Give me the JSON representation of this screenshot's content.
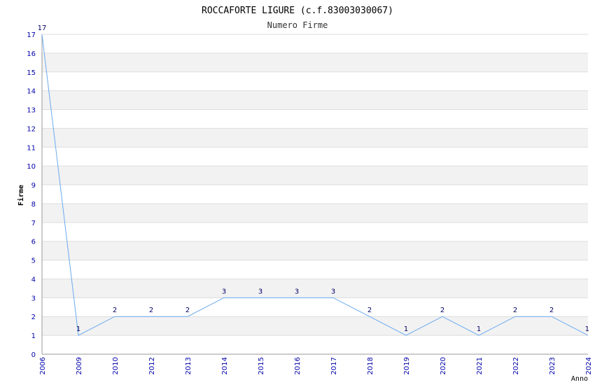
{
  "colors": {
    "band_shaded": "#f2f2f2",
    "band_plain": "#ffffff",
    "grid": "#dddddd",
    "line": "#6aaaf0",
    "tick_text": "#0000aa",
    "label_text": "#000066"
  },
  "chart_data": {
    "type": "line",
    "title": "ROCCAFORTE LIGURE (c.f.83003030067)",
    "subtitle": "Numero Firme",
    "xlabel": "Anno",
    "ylabel": "Firme",
    "ylim": [
      0,
      17
    ],
    "yticks": [
      0,
      1,
      2,
      3,
      4,
      5,
      6,
      7,
      8,
      9,
      10,
      11,
      12,
      13,
      14,
      15,
      16,
      17
    ],
    "categories": [
      "2006",
      "2009",
      "2010",
      "2012",
      "2013",
      "2014",
      "2015",
      "2016",
      "2017",
      "2018",
      "2019",
      "2020",
      "2021",
      "2022",
      "2023",
      "2024"
    ],
    "series": [
      {
        "values": [
          17,
          1,
          2,
          2,
          2,
          3,
          3,
          3,
          3,
          2,
          1,
          2,
          1,
          2,
          2,
          1
        ]
      }
    ],
    "grid": true,
    "legend": "none"
  }
}
